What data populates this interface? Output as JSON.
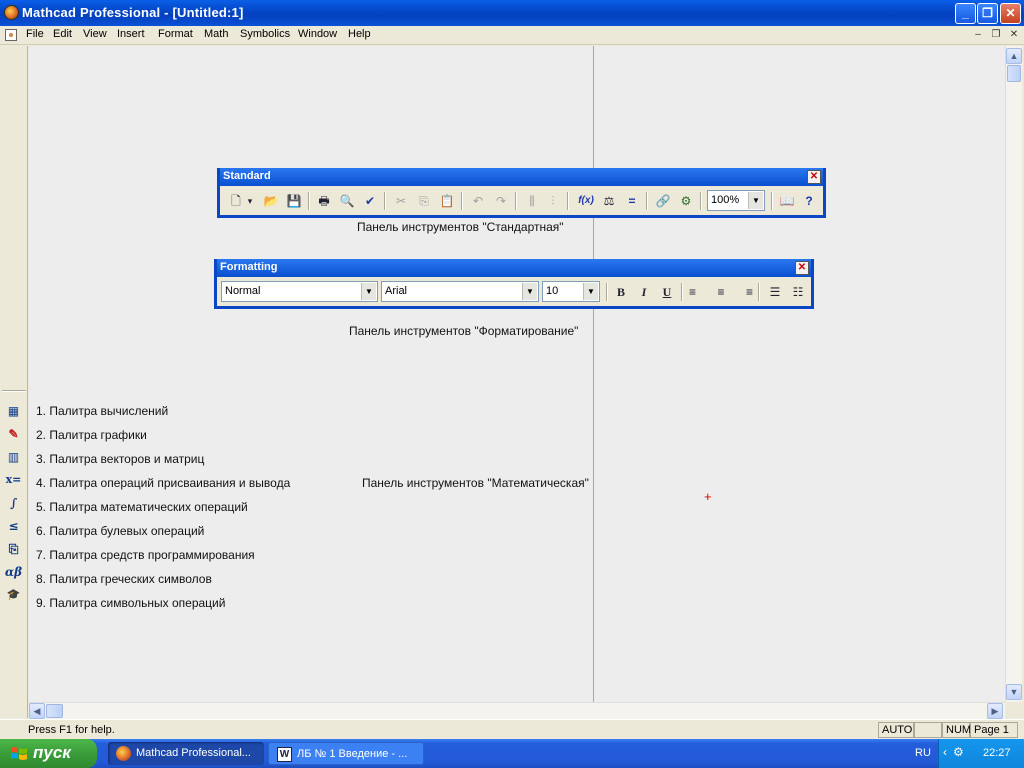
{
  "window": {
    "title": "Mathcad Professional - [Untitled:1]",
    "controls": [
      "_",
      "❐",
      "✕"
    ]
  },
  "menu": {
    "items": [
      "File",
      "Edit",
      "View",
      "Insert",
      "Format",
      "Math",
      "Symbolics",
      "Window",
      "Help"
    ],
    "doc_controls": [
      "–",
      "❐",
      "✕"
    ]
  },
  "math_palettes": [
    {
      "icon": "calculator-icon",
      "glyph": "▦"
    },
    {
      "icon": "graph-icon",
      "glyph": "✎"
    },
    {
      "icon": "matrix-icon",
      "glyph": "▥"
    },
    {
      "icon": "evaluation-icon",
      "glyph": "x="
    },
    {
      "icon": "calculus-icon",
      "glyph": "∫"
    },
    {
      "icon": "boolean-icon",
      "glyph": "≤"
    },
    {
      "icon": "programming-icon",
      "glyph": "⎘"
    },
    {
      "icon": "greek-icon",
      "glyph": "αβ"
    },
    {
      "icon": "symbolic-icon",
      "glyph": "🎓"
    }
  ],
  "standard_toolbar": {
    "title": "Standard",
    "caption": "Панель инструментов \"Стандартная\"",
    "zoom": "100%",
    "tools": [
      {
        "name": "new-icon",
        "glyph": "🗋"
      },
      {
        "name": "new-dropdown-icon",
        "glyph": "▾"
      },
      {
        "name": "open-icon",
        "glyph": "📂"
      },
      {
        "name": "save-icon",
        "glyph": "💾"
      },
      {
        "name": "print-icon",
        "glyph": "🖶"
      },
      {
        "name": "print-preview-icon",
        "glyph": "🔍"
      },
      {
        "name": "spell-check-icon",
        "glyph": "✔"
      },
      {
        "name": "cut-icon",
        "glyph": "✂"
      },
      {
        "name": "copy-icon",
        "glyph": "⎘"
      },
      {
        "name": "paste-icon",
        "glyph": "📋"
      },
      {
        "name": "undo-icon",
        "glyph": "↶"
      },
      {
        "name": "redo-icon",
        "glyph": "↷"
      },
      {
        "name": "align-across-icon",
        "glyph": "⫼"
      },
      {
        "name": "align-down-icon",
        "glyph": "⫶"
      },
      {
        "name": "insert-function-icon",
        "glyph": "f(x)"
      },
      {
        "name": "insert-unit-icon",
        "glyph": "⚖"
      },
      {
        "name": "calculate-icon",
        "glyph": "="
      },
      {
        "name": "insert-hyperlink-icon",
        "glyph": "🔗"
      },
      {
        "name": "insert-component-icon",
        "glyph": "⚙"
      },
      {
        "name": "resource-center-icon",
        "glyph": "📖"
      },
      {
        "name": "help-icon",
        "glyph": "?"
      }
    ]
  },
  "formatting_toolbar": {
    "title": "Formatting",
    "caption": "Панель инструментов \"Форматирование\"",
    "style": "Normal",
    "font": "Arial",
    "size": "10",
    "tools": [
      {
        "name": "bold-icon",
        "glyph": "B"
      },
      {
        "name": "italic-icon",
        "glyph": "I"
      },
      {
        "name": "underline-icon",
        "glyph": "U"
      },
      {
        "name": "align-left-icon",
        "glyph": "≡"
      },
      {
        "name": "align-center-icon",
        "glyph": "≡"
      },
      {
        "name": "align-right-icon",
        "glyph": "≡"
      },
      {
        "name": "bullets-icon",
        "glyph": "☰"
      },
      {
        "name": "numbering-icon",
        "glyph": "☷"
      }
    ]
  },
  "worksheet": {
    "palette_list": [
      "1. Палитра вычислений",
      "2. Палитра графики",
      "3. Палитра векторов и матриц",
      "4. Палитра операций присваивания и вывода",
      "5. Палитра математических операций",
      "6. Палитра булевых операций",
      "7. Палитра средств программирования",
      "8. Палитра греческих символов",
      "9. Палитра символьных операций"
    ],
    "math_toolbar_caption": "Панель инструментов \"Математическая\""
  },
  "status": {
    "help": "Press F1 for help.",
    "mode": "AUTO",
    "num": "NUM",
    "page": "Page 1"
  },
  "taskbar": {
    "start": "пуск",
    "tasks": [
      "Mathcad Professional...",
      "ЛБ № 1 Введение - ..."
    ],
    "lang": "RU",
    "time": "22:27"
  },
  "colors": {
    "titlebar": "#0447c8",
    "start_button": "#3a9d3a",
    "cursor": "#dd0000"
  }
}
